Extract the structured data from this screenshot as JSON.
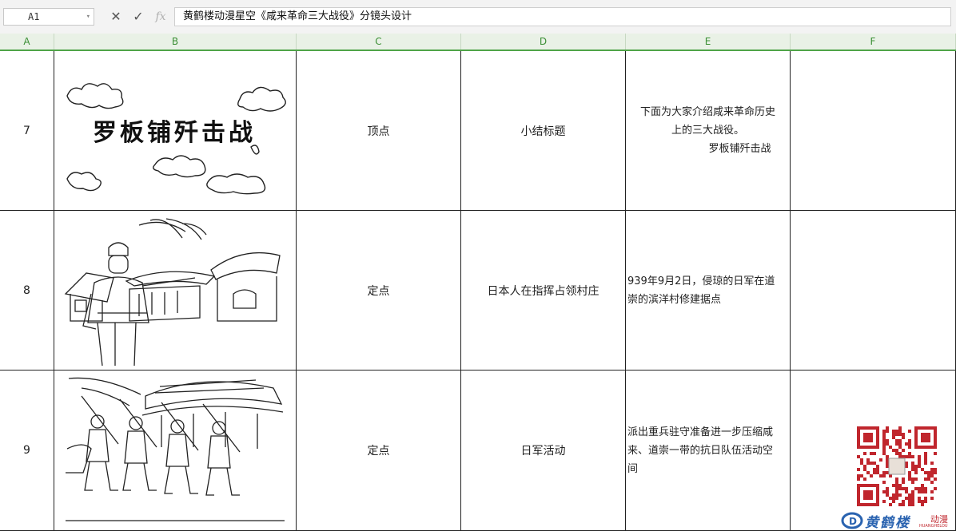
{
  "formula_bar": {
    "cell_ref": "A1",
    "fx_label": "fx",
    "content": "黄鹤楼动漫星空《咸来革命三大战役》分镜头设计"
  },
  "columns": [
    "A",
    "B",
    "C",
    "D",
    "E",
    "F"
  ],
  "rows": [
    {
      "num": "7",
      "image_title": "罗板铺歼击战",
      "shot": "顶点",
      "content": "小结标题",
      "desc_lines": [
        "下面为大家介绍咸来革命历史",
        "上的三大战役。",
        "罗板铺歼击战"
      ]
    },
    {
      "num": "8",
      "shot": "定点",
      "content": "日本人在指挥占领村庄",
      "desc_lines": [
        "939年9月2日，侵琼的日军在道",
        "崇的滨洋村修建据点"
      ]
    },
    {
      "num": "9",
      "shot": "定点",
      "content": "日军活动",
      "desc_lines": [
        "派出重兵驻守准备进一步压缩咸",
        "来、道崇一带的抗日队伍活动空",
        "间"
      ]
    }
  ],
  "watermark": {
    "brand_text": "黄鹤楼",
    "brand_suffix": "动漫",
    "brand_small": "HUANGHELOU",
    "accent_color": "#c0262d",
    "blue_color": "#2a63b0"
  }
}
